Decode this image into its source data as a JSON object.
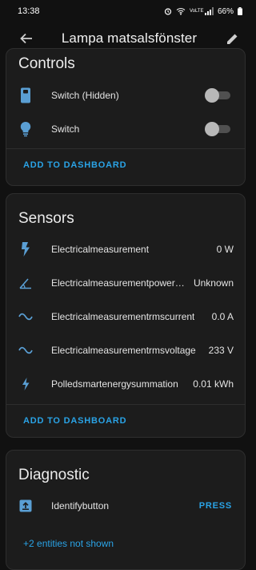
{
  "status_bar": {
    "time": "13:38",
    "network": "VoLTE",
    "battery": "66%"
  },
  "app_bar": {
    "title": "Lampa matsalsfönster",
    "back_icon": "arrow-left-icon",
    "edit_icon": "pencil-icon"
  },
  "controls": {
    "title": "Controls",
    "items": [
      {
        "label": "Switch (Hidden)",
        "icon": "remote-icon",
        "state": "off"
      },
      {
        "label": "Switch",
        "icon": "lightbulb-icon",
        "state": "off"
      }
    ],
    "action_label": "ADD TO DASHBOARD"
  },
  "sensors": {
    "title": "Sensors",
    "items": [
      {
        "label": "Electricalmeasurement",
        "value": "0 W",
        "icon": "flash-icon"
      },
      {
        "label": "Electricalmeasurementpower…",
        "value": "Unknown",
        "icon": "angle-icon"
      },
      {
        "label": "Electricalmeasurementrmscurrent",
        "value": "0.0 A",
        "icon": "sine-wave-icon"
      },
      {
        "label": "Electricalmeasurementrmsvoltage",
        "value": "233 V",
        "icon": "sine-wave-icon"
      },
      {
        "label": "Polledsmartenergysummation",
        "value": "0.01 kWh",
        "icon": "lightning-icon"
      }
    ],
    "action_label": "ADD TO DASHBOARD"
  },
  "diagnostic": {
    "title": "Diagnostic",
    "items": [
      {
        "label": "Identifybutton",
        "action": "PRESS",
        "icon": "upload-box-icon"
      }
    ],
    "more_link": "+2 entities not shown"
  },
  "colors": {
    "background": "#111111",
    "card": "#1c1c1c",
    "accent": "#2aa3e6",
    "icon": "#5a9fd4"
  }
}
